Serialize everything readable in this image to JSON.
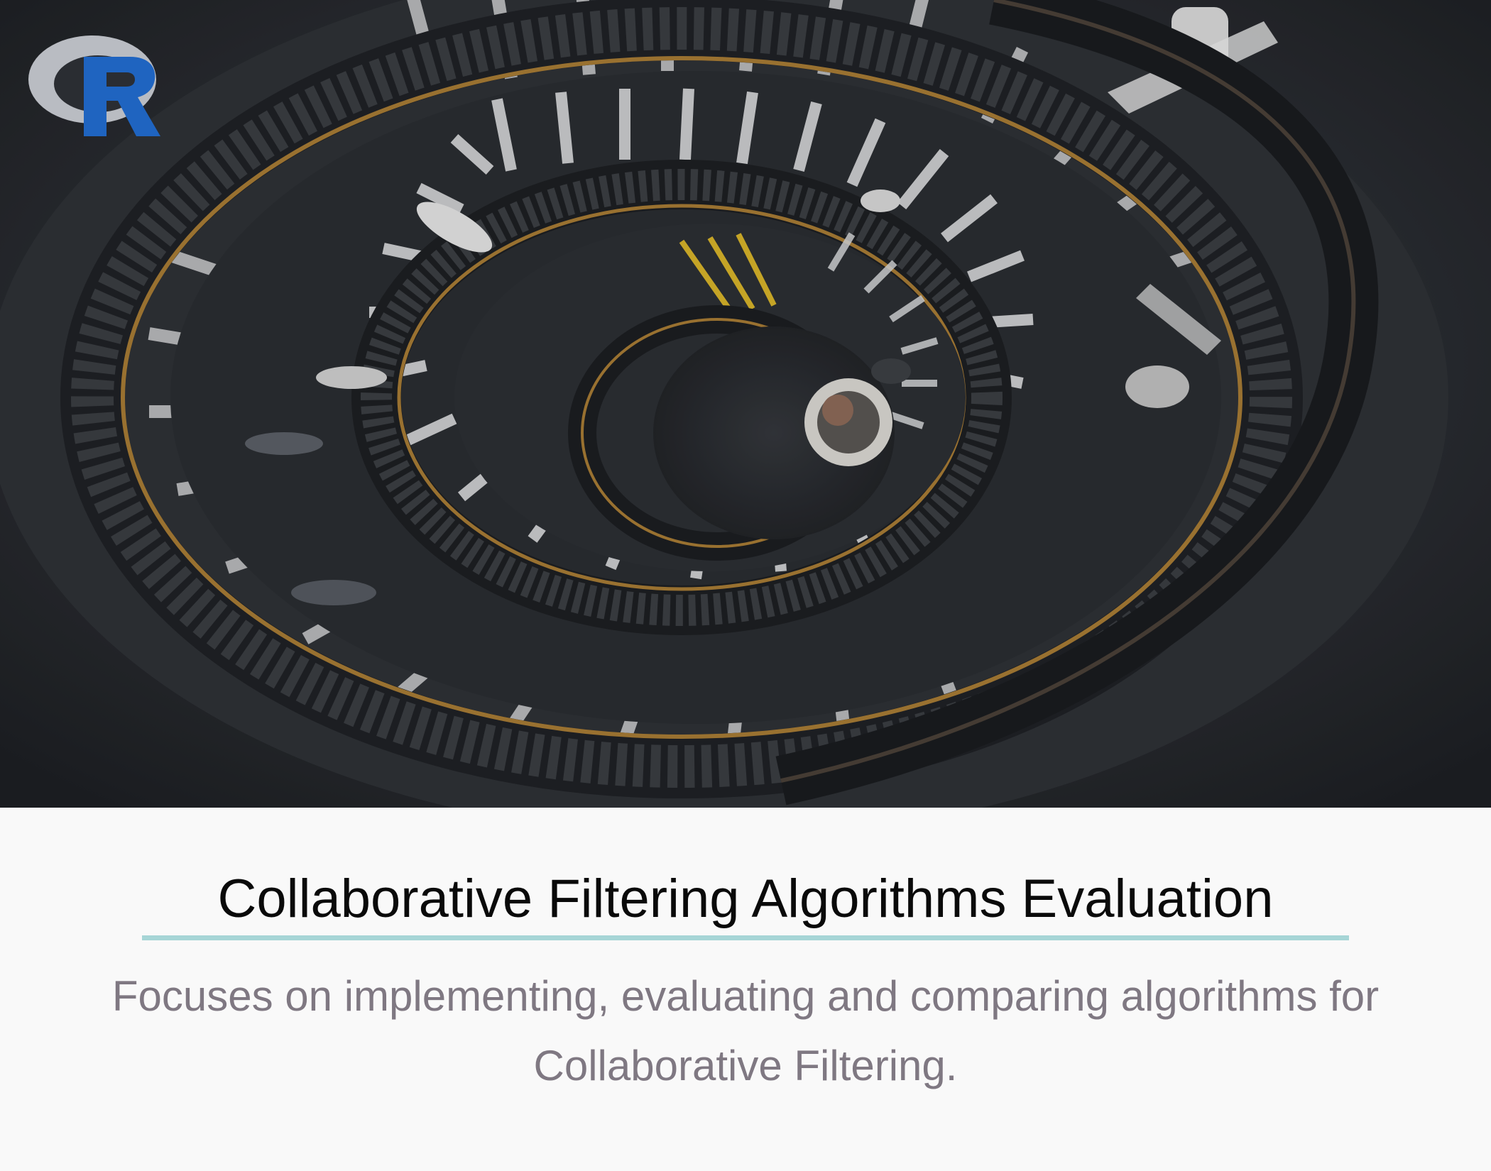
{
  "hero": {
    "image_subject": "spiral-staircase-photo",
    "logo": "r-logo",
    "colors": {
      "logo_ring": "#b9bcc2",
      "logo_letter": "#1f64c0",
      "rail_gold": "#a77b35",
      "stair_light": "#d9dadb",
      "stair_dark": "#2f3237"
    }
  },
  "caption": {
    "title": "Collaborative Filtering Algorithms Evaluation",
    "subtitle": "Focuses on implementing, evaluating and comparing algorithms for Collaborative Filtering.",
    "accent_color": "#a6d5d6",
    "title_color": "#0a0a0a",
    "subtitle_color": "#7f7882"
  }
}
